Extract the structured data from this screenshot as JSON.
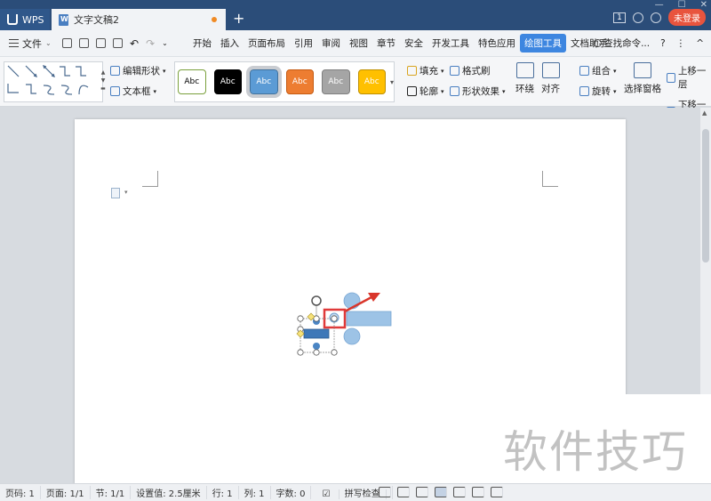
{
  "titlebar": {
    "app_tab": "WPS",
    "doc_tab": "文字文稿2",
    "new_tab": "+",
    "page_count_badge": "1",
    "login_button": "未登录"
  },
  "menubar": {
    "file_menu": "文件",
    "tabs": [
      "开始",
      "插入",
      "页面布局",
      "引用",
      "审阅",
      "视图",
      "章节",
      "安全",
      "开发工具",
      "特色应用",
      "绘图工具",
      "文档助手"
    ],
    "active_tab": "绘图工具",
    "search": "查找命令...",
    "help": "?",
    "more": "⋮",
    "collapse": "^"
  },
  "ribbon": {
    "edit_shape": "编辑形状",
    "text_box": "文本框",
    "style_presets": [
      {
        "label": "Abc",
        "bg": "#ffffff",
        "border": "#7aa03c",
        "color": "#000000"
      },
      {
        "label": "Abc",
        "bg": "#000000",
        "border": "#000000",
        "color": "#ffffff"
      },
      {
        "label": "Abc",
        "bg": "#5b9bd5",
        "border": "#41719c",
        "color": "#ffffff"
      },
      {
        "label": "Abc",
        "bg": "#ed7d31",
        "border": "#c55a11",
        "color": "#ffffff"
      },
      {
        "label": "Abc",
        "bg": "#a5a5a5",
        "border": "#7f7f7f",
        "color": "#ffffff"
      },
      {
        "label": "Abc",
        "bg": "#ffc000",
        "border": "#bf9000",
        "color": "#ffffff"
      }
    ],
    "selected_style_index": 2,
    "fill": "填充",
    "format_painter": "格式刷",
    "outline": "轮廓",
    "shape_effects": "形状效果",
    "wrap": "环绕",
    "align": "对齐",
    "group": "组合",
    "rotate": "旋转",
    "selection_pane": "选择窗格",
    "bring_forward": "上移一层",
    "send_backward": "下移一层"
  },
  "statusbar": {
    "page_num": "页码: 1",
    "pages": "页面: 1/1",
    "section": "节: 1/1",
    "setting": "设置值: 2.5厘米",
    "row": "行: 1",
    "col": "列: 1",
    "word_count": "字数: 0",
    "spell_check": "拼写检查"
  },
  "watermark": "软件技巧",
  "colors": {
    "titlebar": "#2b4d79",
    "accent": "#3d86e0",
    "shape_fill": "#9dc3e6",
    "selection_red": "#e03a3a"
  }
}
